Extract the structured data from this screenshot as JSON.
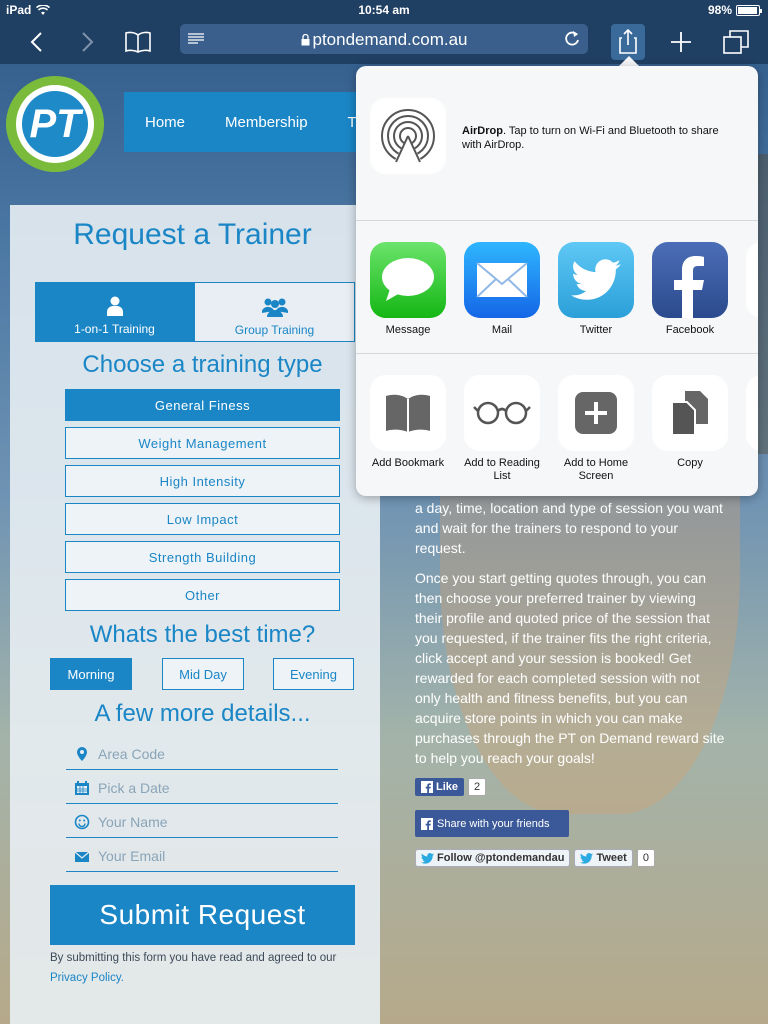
{
  "status": {
    "device": "iPad",
    "time": "10:54 am",
    "battery": "98%"
  },
  "browser": {
    "url": "ptondemand.com.au"
  },
  "site": {
    "logo_text": "PT",
    "nav": [
      "Home",
      "Membership",
      "Tr"
    ]
  },
  "form": {
    "title": "Request a Trainer",
    "tabs": [
      "1-on-1 Training",
      "Group Training"
    ],
    "type_heading": "Choose a training type",
    "types": [
      "General Finess",
      "Weight Management",
      "High Intensity",
      "Low Impact",
      "Strength Building",
      "Other"
    ],
    "time_heading": "Whats the best time?",
    "times": [
      "Morning",
      "Mid Day",
      "Evening"
    ],
    "details_heading": "A few more details...",
    "placeholders": {
      "area_code": "Area Code",
      "date": "Pick a Date",
      "name": "Your Name",
      "email": "Your Email"
    },
    "submit": "Submit Request",
    "disclaimer": "By submitting this form you have read and agreed to our",
    "privacy_link": "Privacy Policy."
  },
  "content": {
    "para1": "a day, time, location and type of session you want and wait for the trainers to respond to your request.",
    "para2": "Once you start getting quotes through, you can then choose your preferred trainer by viewing their profile and quoted price of the session that you requested, if the trainer fits the right criteria, click accept and your session is booked! Get rewarded for each completed session with not only health and fitness benefits, but you can acquire store points in which you can make purchases through the PT on Demand reward site to help you reach your goals!",
    "like_label": "Like",
    "like_count": "2",
    "share_label": "Share with your friends",
    "follow_label": "Follow @ptondemandau",
    "tweet_label": "Tweet",
    "tweet_count": "0"
  },
  "share_sheet": {
    "airdrop_title": "AirDrop",
    "airdrop_text": ". Tap to turn on Wi-Fi and Bluetooth to share with AirDrop.",
    "apps": [
      "Message",
      "Mail",
      "Twitter",
      "Facebook"
    ],
    "actions": [
      "Add Bookmark",
      "Add to Reading List",
      "Add to Home Screen",
      "Copy"
    ]
  },
  "colors": {
    "brand_blue": "#1a86c6",
    "facebook": "#3b5998"
  }
}
